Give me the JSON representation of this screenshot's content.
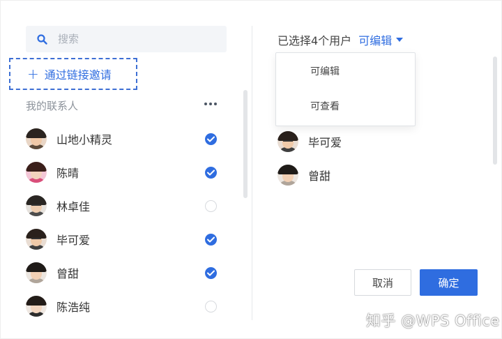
{
  "search": {
    "placeholder": "搜索",
    "icon": "search-icon"
  },
  "invite": {
    "label": "通过链接邀请",
    "icon": "plus-icon"
  },
  "contacts_section": {
    "title": "我的联系人",
    "more_icon": "more-horizontal-icon"
  },
  "contacts": [
    {
      "name": "山地小精灵",
      "checked": true
    },
    {
      "name": "陈晴",
      "checked": true
    },
    {
      "name": "林卓佳",
      "checked": false
    },
    {
      "name": "毕可爱",
      "checked": true
    },
    {
      "name": "曾甜",
      "checked": true
    },
    {
      "name": "陈浩纯",
      "checked": false
    }
  ],
  "selected": {
    "count_text": "已选择4个用户",
    "permission": "可编辑",
    "items": [
      {
        "name": "毕可爱"
      },
      {
        "name": "曾甜"
      }
    ]
  },
  "permission_dropdown": {
    "options": [
      "可编辑",
      "可查看"
    ]
  },
  "buttons": {
    "cancel": "取消",
    "confirm": "确定"
  },
  "watermark": "知乎 @WPS Office",
  "colors": {
    "accent": "#2f6de0",
    "text": "#333333",
    "muted": "#8d939b",
    "border": "#e6e8eb"
  }
}
